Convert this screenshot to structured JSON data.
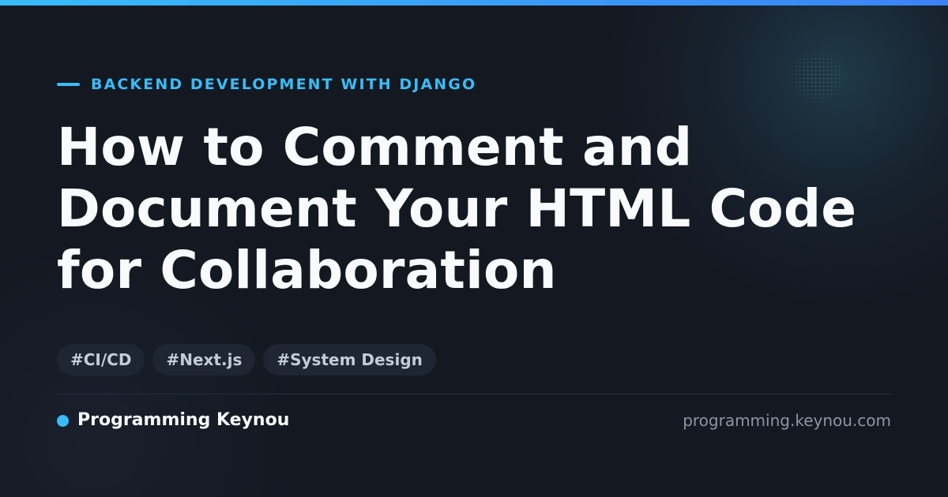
{
  "header": {
    "category": "BACKEND DEVELOPMENT WITH DJANGO"
  },
  "article": {
    "title": "How to Comment and\nDocument Your HTML Code\nfor Collaboration"
  },
  "tags": [
    "#CI/CD",
    "#Next.js",
    "#System Design"
  ],
  "footer": {
    "brand_name": "Programming Keynou",
    "site_url": "programming.keynou.com"
  },
  "colors": {
    "accent": "#38bdf8",
    "accent_end": "#3b82f6",
    "background": "#141821",
    "title_text": "#f8fafc",
    "tag_background": "#1d2632",
    "tag_text": "#c3ccd8",
    "muted_text": "#8b95a5"
  },
  "icons": {
    "kicker": "accent-line-icon",
    "brand": "brand-dot-icon",
    "decoration": "dot-pattern"
  }
}
